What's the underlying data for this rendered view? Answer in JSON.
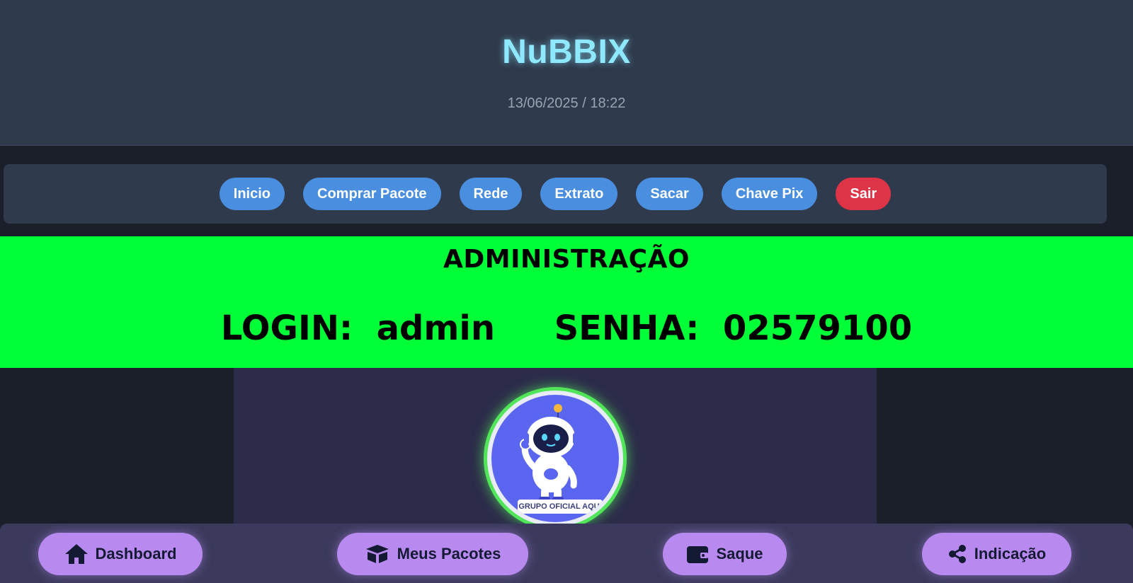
{
  "header": {
    "brand": "NuBBIX",
    "datetime": "13/06/2025 / 18:22"
  },
  "nav": {
    "items": [
      {
        "label": "Inicio"
      },
      {
        "label": "Comprar Pacote"
      },
      {
        "label": "Rede"
      },
      {
        "label": "Extrato"
      },
      {
        "label": "Sacar"
      },
      {
        "label": "Chave Pix"
      },
      {
        "label": "Sair"
      }
    ]
  },
  "banner": {
    "title": "ADMINISTRAÇÃO",
    "login_label": "LOGIN:",
    "login_value": "admin",
    "password_label": "SENHA:",
    "password_value": "02579100"
  },
  "avatar": {
    "caption": "GRUPO OFICIAL AQUI"
  },
  "bottom_nav": {
    "items": [
      {
        "label": "Dashboard",
        "icon": "home-icon"
      },
      {
        "label": "Meus Pacotes",
        "icon": "box-icon"
      },
      {
        "label": "Saque",
        "icon": "wallet-icon"
      },
      {
        "label": "Indicação",
        "icon": "share-icon"
      }
    ]
  },
  "colors": {
    "brand": "#8ee8ff",
    "nav_button": "#4a8ee0",
    "exit_button": "#de3447",
    "banner": "#00ff37",
    "bottom_button": "#b88af0",
    "avatar_ring": "#52e55a"
  }
}
